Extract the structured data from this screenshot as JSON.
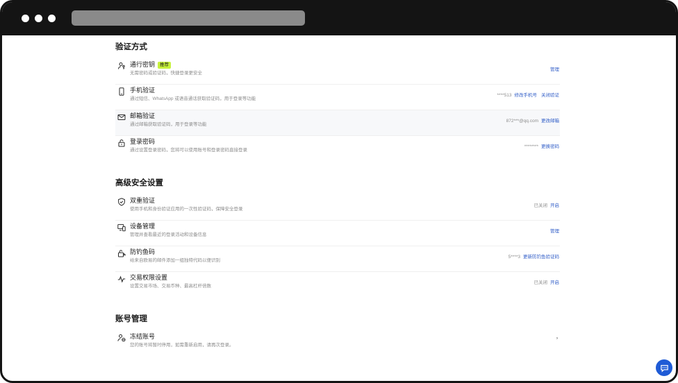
{
  "sections": [
    {
      "title": "验证方式",
      "rows": [
        {
          "icon": "user-key-icon",
          "title": "通行密钥",
          "badge": "推荐",
          "desc": "无需密码或验证码，快捷登录更安全",
          "value": "",
          "links": [
            "管理"
          ]
        },
        {
          "icon": "phone-icon",
          "title": "手机验证",
          "badge": "",
          "desc": "通过短信、WhatsApp 或语音通话获取验证码，用于登录等功能",
          "value": "****513",
          "links": [
            "修改手机号",
            "关闭验证"
          ]
        },
        {
          "icon": "mail-icon",
          "title": "邮箱验证",
          "badge": "",
          "desc": "通过邮箱获取验证码，用于登录等功能",
          "value": "872***@qq.com",
          "links": [
            "更改邮箱"
          ]
        },
        {
          "icon": "lock-icon",
          "title": "登录密码",
          "badge": "",
          "desc": "通过设置登录密码，您将可以使用账号和登录密码直接登录",
          "value": "********",
          "links": [
            "更换密码"
          ]
        }
      ]
    },
    {
      "title": "高级安全设置",
      "rows": [
        {
          "icon": "shield-check-icon",
          "title": "双重验证",
          "badge": "",
          "desc": "使用手机和身份验证应用的一次性验证码，保障安全登录",
          "value": "已关闭",
          "links": [
            "开启"
          ]
        },
        {
          "icon": "devices-icon",
          "title": "设备管理",
          "badge": "",
          "desc": "管理并查看最近的登录活动和设备信息",
          "value": "",
          "links": [
            "管理"
          ]
        },
        {
          "icon": "anti-phishing-icon",
          "title": "防钓鱼码",
          "badge": "",
          "desc": "给来自欧易的邮件添加一组独特代码以便识别",
          "value": "5****3",
          "links": [
            "更新防钓鱼验证码"
          ]
        },
        {
          "icon": "pulse-icon",
          "title": "交易权限设置",
          "badge": "",
          "desc": "设置交易市场、交易币种、最高杠杆倍数",
          "value": "已关闭",
          "links": [
            "开启"
          ]
        }
      ]
    },
    {
      "title": "账号管理",
      "rows": [
        {
          "icon": "freeze-user-icon",
          "title": "冻结账号",
          "badge": "",
          "desc": "您的账号将暂时停用，如需重新启用，请再次登录。",
          "value": "",
          "links": [],
          "chevron": "›"
        }
      ]
    }
  ]
}
